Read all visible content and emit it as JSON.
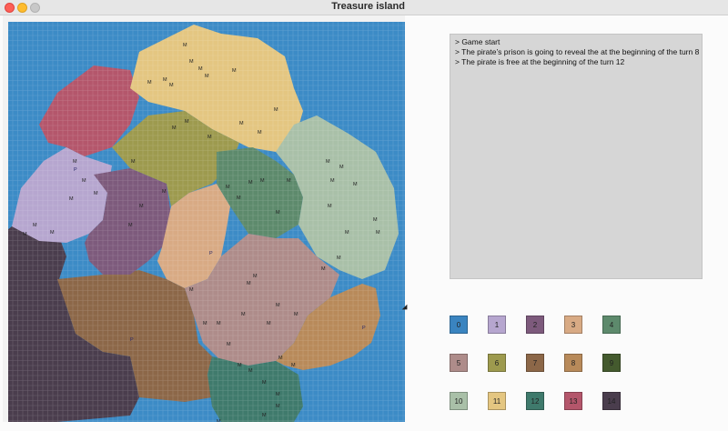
{
  "window": {
    "title": "Treasure island"
  },
  "log": [
    "> Game start",
    "> The pirate’s prison is going to reveal the at the beginning of the turn 8",
    "> The pirate is free at the beginning of the turn 12"
  ],
  "colors": {
    "sea": "#3c8bc6",
    "region_0": "#3a84c0",
    "region_1": "#b6a6cf",
    "region_2": "#7d5a7c",
    "region_3": "#d8aa84",
    "region_4": "#5d8a6c",
    "region_5": "#ae8c8a",
    "region_6": "#9d9a4e",
    "region_7": "#8c6748",
    "region_8": "#b88a5a",
    "region_9": "#445a2e",
    "region_10": "#a9c0a8",
    "region_11": "#e4c681",
    "region_12": "#3f7a6c",
    "region_13": "#b4566b",
    "region_14": "#4a3d4d"
  },
  "legend": [
    {
      "label": "0",
      "color": "#3a84c0"
    },
    {
      "label": "1",
      "color": "#b6a6cf"
    },
    {
      "label": "2",
      "color": "#7d5a7c"
    },
    {
      "label": "3",
      "color": "#d8aa84"
    },
    {
      "label": "4",
      "color": "#5d8a6c"
    },
    {
      "label": "5",
      "color": "#ae8c8a"
    },
    {
      "label": "6",
      "color": "#9d9a4e"
    },
    {
      "label": "7",
      "color": "#8c6748"
    },
    {
      "label": "8",
      "color": "#b88a5a"
    },
    {
      "label": "9",
      "color": "#445a2e"
    },
    {
      "label": "10",
      "color": "#a9c0a8"
    },
    {
      "label": "11",
      "color": "#e4c681"
    },
    {
      "label": "12",
      "color": "#3f7a6c"
    },
    {
      "label": "13",
      "color": "#b4566b"
    },
    {
      "label": "14",
      "color": "#4a3d4d"
    }
  ],
  "board": {
    "marker_m": "M",
    "marker_p": "P"
  }
}
